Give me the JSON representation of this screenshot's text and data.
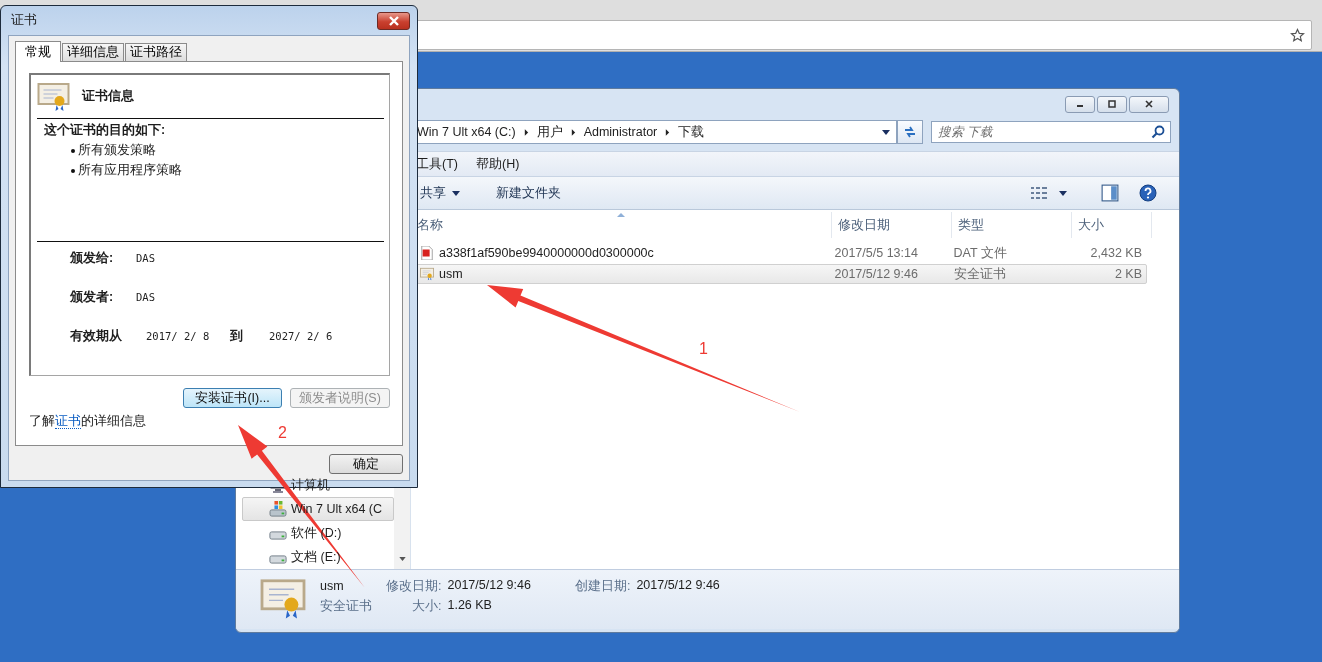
{
  "explorer": {
    "breadcrumb": [
      "Win 7 Ult x64 (C:)",
      "用户",
      "Administrator",
      "下载"
    ],
    "search": {
      "placeholder": "搜索 下载"
    },
    "menu": [
      "工具(T)",
      "帮助(H)"
    ],
    "toolbar": [
      {
        "label": "共享",
        "dropdown": true
      },
      {
        "label": "新建文件夹",
        "dropdown": false
      }
    ],
    "columns": [
      "名称",
      "修改日期",
      "类型",
      "大小"
    ],
    "files": [
      {
        "kind": "dat",
        "name": "a338f1af590be9940000000d0300000c",
        "modified": "2017/5/5 13:14",
        "type": "DAT 文件",
        "size": "2,432 KB",
        "selected": false
      },
      {
        "kind": "cert",
        "name": "usm",
        "modified": "2017/5/12 9:46",
        "type": "安全证书",
        "size": "2 KB",
        "selected": true
      }
    ],
    "nav": [
      {
        "kind": "computer",
        "label": "计算机",
        "selected": false
      },
      {
        "kind": "system",
        "label": "Win 7 Ult x64 (C",
        "selected": true
      },
      {
        "kind": "drive",
        "label": "软件 (D:)",
        "selected": false
      },
      {
        "kind": "drive",
        "label": "文档 (E:)",
        "selected": false
      }
    ],
    "details": {
      "name": "usm",
      "type": "安全证书",
      "fields": [
        {
          "label": "修改日期:",
          "value": "2017/5/12 9:46"
        },
        {
          "label": "大小:",
          "value": "1.26 KB"
        },
        {
          "label": "创建日期:",
          "value": "2017/5/12 9:46"
        }
      ]
    }
  },
  "dialog": {
    "title": "证书",
    "tabs": [
      {
        "label": "常规",
        "selected": true
      },
      {
        "label": "详细信息",
        "selected": false
      },
      {
        "label": "证书路径",
        "selected": false
      }
    ],
    "heading": "证书信息",
    "purpose_title": "这个证书的目的如下:",
    "purposes": [
      "所有颁发策略",
      "所有应用程序策略"
    ],
    "issued_to": {
      "label": "颁发给:",
      "value": "DAS"
    },
    "issued_by": {
      "label": "颁发者:",
      "value": "DAS"
    },
    "validity": {
      "label": "有效期从",
      "from": "2017/ 2/ 8",
      "to_label": "到",
      "to": "2027/ 2/ 6"
    },
    "buttons": [
      {
        "label": "安装证书(I)...",
        "disabled": false
      },
      {
        "label": "颁发者说明(S)",
        "disabled": true
      }
    ],
    "info": {
      "before": "了解",
      "link": "证书",
      "after": "的详细信息"
    },
    "ok": "确定"
  },
  "annotations": [
    {
      "label": "1"
    },
    {
      "label": "2"
    }
  ]
}
